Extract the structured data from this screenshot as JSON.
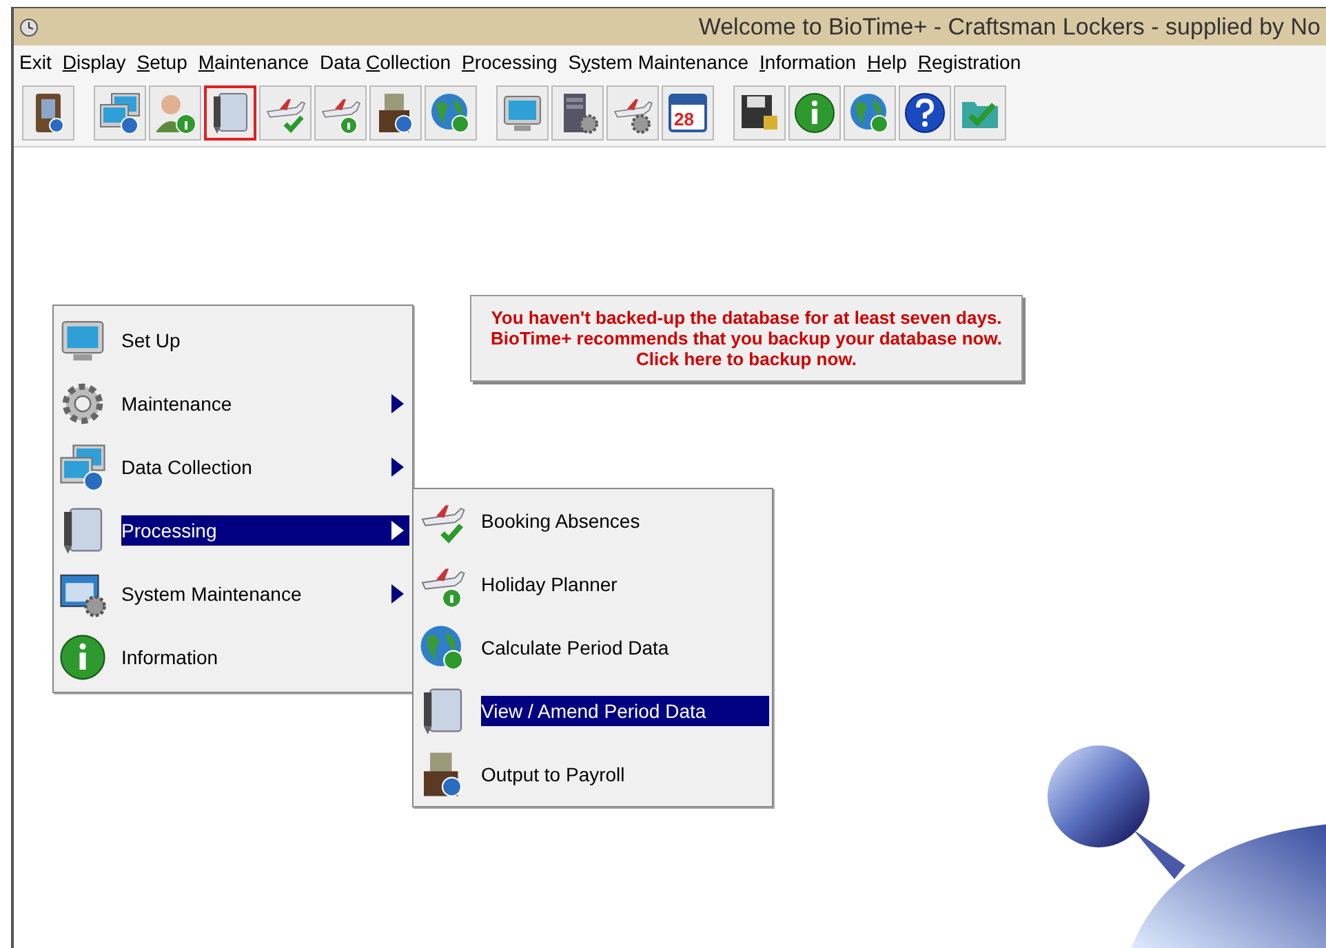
{
  "window": {
    "title": "Welcome to BioTime+ - Craftsman Lockers - supplied by No"
  },
  "menu_bar": [
    {
      "pre": "Exit"
    },
    {
      "key": "D",
      "post": "isplay"
    },
    {
      "key": "S",
      "post": "etup"
    },
    {
      "key": "M",
      "post": "aintenance"
    },
    {
      "pre": "Data ",
      "key": "C",
      "post": "ollection"
    },
    {
      "key": "P",
      "post": "rocessing"
    },
    {
      "pre": "S",
      "key": "y",
      "post": "stem Maintenance"
    },
    {
      "key": "I",
      "post": "nformation"
    },
    {
      "key": "H",
      "post": "elp"
    },
    {
      "key": "R",
      "post": "egistration"
    }
  ],
  "toolbar": [
    [
      {
        "kind": "door",
        "selected": false
      }
    ],
    [
      {
        "kind": "monitors",
        "selected": false
      },
      {
        "kind": "person",
        "selected": false
      },
      {
        "kind": "notepad",
        "selected": true
      },
      {
        "kind": "plane-check",
        "selected": false
      },
      {
        "kind": "plane-info",
        "selected": false
      },
      {
        "kind": "wallet",
        "selected": false
      },
      {
        "kind": "globe",
        "selected": false
      }
    ],
    [
      {
        "kind": "monitor",
        "selected": false
      },
      {
        "kind": "server",
        "selected": false
      },
      {
        "kind": "plane-gear",
        "selected": false
      },
      {
        "kind": "calendar",
        "selected": false,
        "text": "28"
      }
    ],
    [
      {
        "kind": "floppy",
        "selected": false
      },
      {
        "kind": "info",
        "selected": false
      },
      {
        "kind": "globe",
        "selected": false
      },
      {
        "kind": "help",
        "selected": false
      },
      {
        "kind": "folder-check",
        "selected": false
      }
    ]
  ],
  "backup_notice": "You haven't backed-up the database for at least seven days. BioTime+ recommends that you backup your database now. Click here to backup now.",
  "main_menu": [
    {
      "label": "Set Up",
      "kind": "monitor",
      "submenu": false,
      "selected": false
    },
    {
      "label": "Maintenance",
      "kind": "gear",
      "submenu": true,
      "selected": false
    },
    {
      "label": "Data Collection",
      "kind": "monitors",
      "submenu": true,
      "selected": false
    },
    {
      "label": "Processing",
      "kind": "notepad",
      "submenu": true,
      "selected": true
    },
    {
      "label": "System Maintenance",
      "kind": "windows-gear",
      "submenu": true,
      "selected": false
    },
    {
      "label": "Information",
      "kind": "info",
      "submenu": false,
      "selected": false
    }
  ],
  "submenu": [
    {
      "label": "Booking Absences",
      "kind": "plane-check",
      "selected": false
    },
    {
      "label": "Holiday Planner",
      "kind": "plane-info",
      "selected": false
    },
    {
      "label": "Calculate Period Data",
      "kind": "globe",
      "selected": false
    },
    {
      "label": "View / Amend Period Data",
      "kind": "notepad",
      "selected": true
    },
    {
      "label": "Output to Payroll",
      "kind": "wallet",
      "selected": false
    }
  ]
}
